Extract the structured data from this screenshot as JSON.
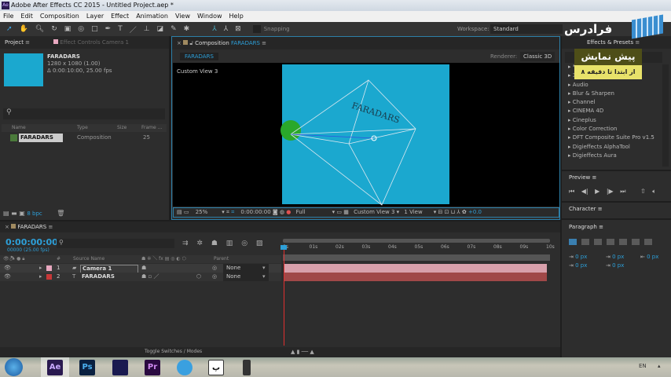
{
  "window": {
    "title": "Adobe After Effects CC 2015 - Untitled Project.aep *",
    "app_badge": "Ae"
  },
  "menu": [
    "File",
    "Edit",
    "Composition",
    "Layer",
    "Effect",
    "Animation",
    "View",
    "Window",
    "Help"
  ],
  "toolbar": {
    "snapping": "Snapping",
    "workspace_label": "Workspace:",
    "workspace_value": "Standard"
  },
  "project": {
    "tab": "Project",
    "effect_controls_tab": "Effect Controls Camera 1",
    "comp_name": "FARADARS",
    "comp_size": "1280 x 1080 (1.00)",
    "comp_duration": "Δ 0:00:10:00, 25.00 fps",
    "columns": [
      "Name",
      "Type",
      "Size",
      "Frame ..."
    ],
    "items": [
      {
        "name": "FARADARS",
        "type": "Composition",
        "size": "",
        "frame": "25"
      }
    ],
    "bpc": "8 bpc",
    "thumb_color": "#1ba8cf"
  },
  "composition": {
    "tab_prefix": "Composition",
    "tab_name": "FARADARS",
    "breadcrumb": "FARADARS",
    "renderer_label": "Renderer:",
    "renderer_value": "Classic 3D",
    "view_label": "Custom View 3",
    "layer_text": "FARADARS",
    "bg_color": "#1ba8cf",
    "zoom": "25%",
    "timecode": "0:00:00:00",
    "resolution": "Full",
    "view_select": "Custom View 3",
    "views": "1 View",
    "exposure": "+0.0"
  },
  "effects": {
    "tab": "Effects & Presets",
    "items": [
      "Audio",
      "Blur & Sharpen",
      "Channel",
      "CINEMA 4D",
      "Cineplus",
      "Color Correction",
      "DFT Composite Suite Pro v1.5",
      "Digieffects AlphaTool",
      "Digieffects Aura"
    ]
  },
  "preview": {
    "title": "Preview"
  },
  "character": {
    "title": "Character"
  },
  "paragraph": {
    "title": "Paragraph",
    "values": [
      "0 px",
      "0 px",
      "0 px",
      "0 px",
      "0 px"
    ]
  },
  "watermark": {
    "logo": "فرادرس",
    "banner_title": "پیش نمایش",
    "banner_sub": "از ابتدا تا دقیقه ۸"
  },
  "timeline": {
    "tab": "FARADARS",
    "timecode": "0:00:00:00",
    "frame_info": "00000 (25.00 fps)",
    "columns": {
      "num": "#",
      "source": "Source Name",
      "parent": "Parent"
    },
    "ticks": [
      "0s",
      "01s",
      "02s",
      "03s",
      "04s",
      "05s",
      "06s",
      "07s",
      "08s",
      "09s",
      "10s"
    ],
    "layers": [
      {
        "num": "1",
        "name": "Camera 1",
        "parent": "None",
        "label_color": "#e8a8c0",
        "bar_color": "#d8a0ab"
      },
      {
        "num": "2",
        "name": "FARADARS",
        "parent": "None",
        "label_color": "#c83838",
        "bar_color": "#a04848"
      }
    ],
    "toggle": "Toggle Switches / Modes"
  },
  "taskbar": {
    "apps": [
      "Ae",
      "Ps",
      "",
      "Pr",
      "",
      "پ",
      ""
    ],
    "lang": "EN"
  }
}
